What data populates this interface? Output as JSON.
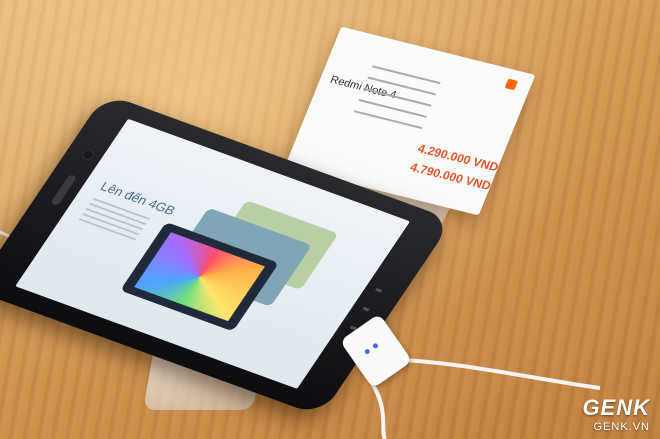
{
  "photo": {
    "scene": "store-display",
    "colors": {
      "table": "#d49a55",
      "price_red": "#e8532a",
      "logo_orange": "#ff6700"
    }
  },
  "price_card": {
    "title": "Redmi Note 4",
    "price_1": "4.290.000 VND",
    "price_2": "4.790.000 VND"
  },
  "phone_screen": {
    "headline": "Lên đến 4GB"
  },
  "watermark": {
    "main": "GENK",
    "sub": "GENK.VN"
  }
}
